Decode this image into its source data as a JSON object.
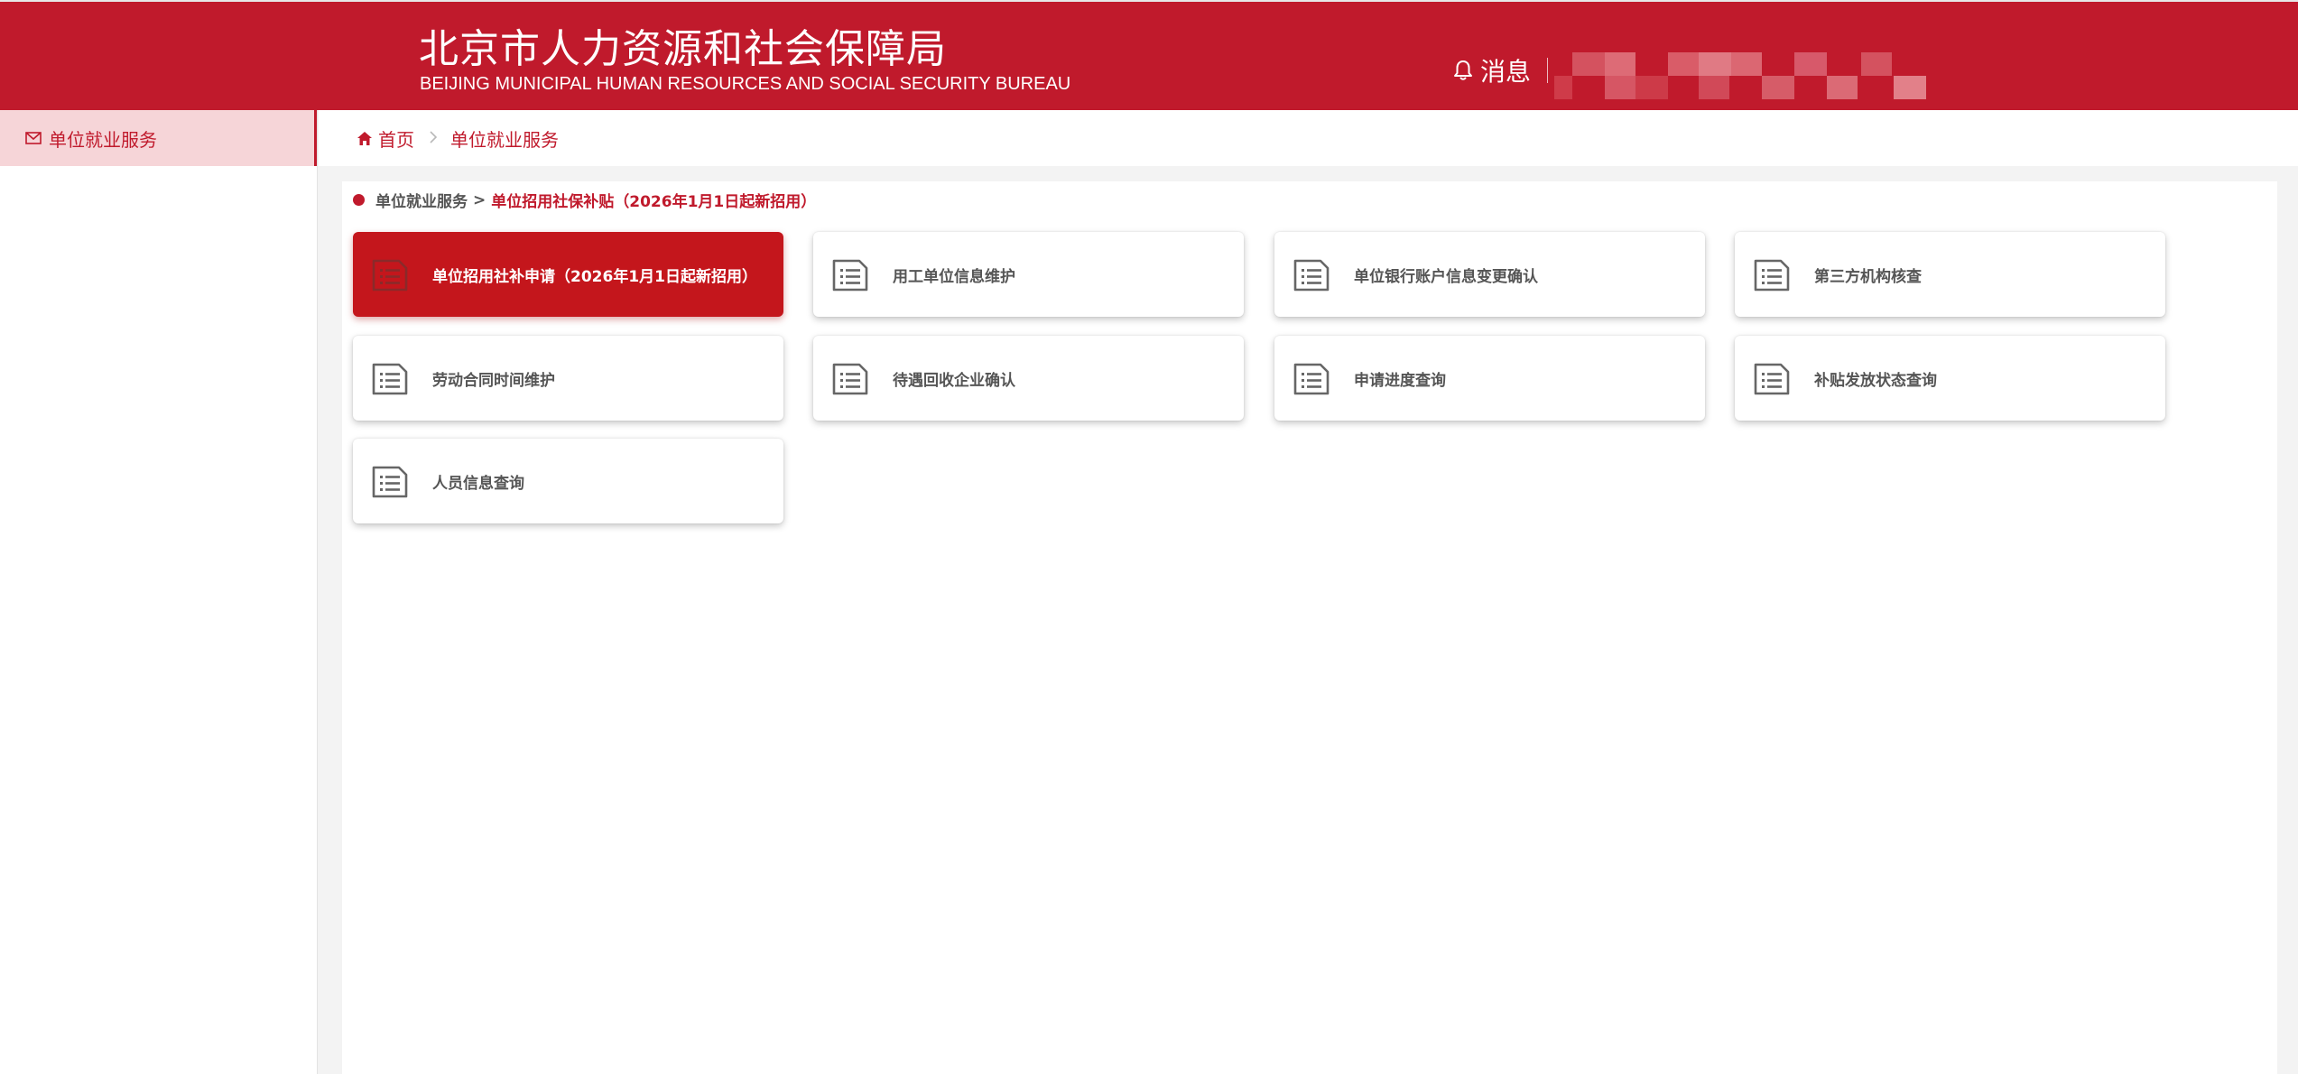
{
  "header": {
    "title_cn": "北京市人力资源和社会保障局",
    "title_en": "BEIJING MUNICIPAL HUMAN RESOURCES AND SOCIAL SECURITY BUREAU",
    "message_label": "消息",
    "message_icon": "bell-icon",
    "bg_color": "#c01a2c"
  },
  "sidebar": {
    "items": [
      {
        "label": "单位就业服务",
        "icon": "mail-icon",
        "active": true
      }
    ]
  },
  "breadcrumb": {
    "home_label": "首页",
    "home_icon": "home-icon",
    "current_label": "单位就业服务"
  },
  "sub_breadcrumb": {
    "parent_label": "单位就业服务",
    "separator": ">",
    "current_label": "单位招用社保补贴（2026年1月1日起新招用）"
  },
  "cards": [
    {
      "label": "单位招用社补申请（2026年1月1日起新招用）",
      "icon": "document-list-icon",
      "active": true
    },
    {
      "label": "用工单位信息维护",
      "icon": "document-list-icon",
      "active": false
    },
    {
      "label": "单位银行账户信息变更确认",
      "icon": "document-list-icon",
      "active": false
    },
    {
      "label": "第三方机构核查",
      "icon": "document-list-icon",
      "active": false
    },
    {
      "label": "劳动合同时间维护",
      "icon": "document-list-icon",
      "active": false
    },
    {
      "label": "待遇回收企业确认",
      "icon": "document-list-icon",
      "active": false
    },
    {
      "label": "申请进度查询",
      "icon": "document-list-icon",
      "active": false
    },
    {
      "label": "补贴发放状态查询",
      "icon": "document-list-icon",
      "active": false
    },
    {
      "label": "人员信息查询",
      "icon": "document-list-icon",
      "active": false
    }
  ],
  "colors": {
    "accent": "#c01a2c",
    "active_card": "#c4161c",
    "sidebar_active_bg": "#f6d5d8"
  }
}
